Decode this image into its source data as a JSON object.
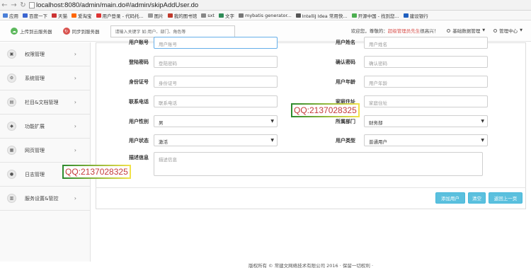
{
  "browser": {
    "url": "localhost:8080/admin/main.do#/admin/skipAddUser.do",
    "bookmarks": [
      {
        "label": "应用",
        "color": "#4a7fd8"
      },
      {
        "label": "百度一下",
        "color": "#3b65d1"
      },
      {
        "label": "天猫",
        "color": "#c33"
      },
      {
        "label": "爱淘宝",
        "color": "#f60"
      },
      {
        "label": "用户登录 - 代码托...",
        "color": "#d33"
      },
      {
        "label": "图片",
        "color": "#999"
      },
      {
        "label": "我的图书馆",
        "color": "#c0392b"
      },
      {
        "label": "sxt",
        "color": "#888"
      },
      {
        "label": "文字",
        "color": "#2e8b57"
      },
      {
        "label": "mybatis generator...",
        "color": "#777"
      },
      {
        "label": "IntelliJ Idea 常用快...",
        "color": "#555"
      },
      {
        "label": "开源中国 - 找到您...",
        "color": "#4caf50"
      },
      {
        "label": "建设银行",
        "color": "#1f5fbf"
      }
    ]
  },
  "header": {
    "upload_label": "上传到云服务器",
    "sync_label": "同步到服务器",
    "search_placeholder": "请输入关键字 如:用户、部门、角色等",
    "welcome_prefix": "欢迎您，尊敬的：",
    "welcome_name": "超级管理员先生",
    "welcome_suffix": " 很高兴！",
    "basic_data": "基础数据管理",
    "admin_center": "管理中心"
  },
  "sidebar": {
    "items": [
      {
        "label": "权限管理",
        "icon": "lock-icon"
      },
      {
        "label": "系统管理",
        "icon": "gear-icon"
      },
      {
        "label": "栏目&文档管理",
        "icon": "document-icon"
      },
      {
        "label": "功能扩展",
        "icon": "plugin-icon"
      },
      {
        "label": "网页管理",
        "icon": "page-icon"
      },
      {
        "label": "日志管理",
        "icon": "log-icon"
      },
      {
        "label": "服务设置&管控",
        "icon": "server-icon"
      }
    ]
  },
  "form": {
    "username": {
      "label": "用户账号",
      "placeholder": "用户账号"
    },
    "realname": {
      "label": "用户姓名",
      "placeholder": "用户姓名"
    },
    "password": {
      "label": "登陆密码",
      "placeholder": "登陆密码"
    },
    "confirm": {
      "label": "确认密码",
      "placeholder": "确认密码"
    },
    "idcard": {
      "label": "身份证号",
      "placeholder": "身份证号"
    },
    "age": {
      "label": "用户年龄",
      "placeholder": "用户年龄"
    },
    "phone": {
      "label": "联系电话",
      "placeholder": "联系电话"
    },
    "address": {
      "label": "家庭住址",
      "placeholder": "家庭住址"
    },
    "gender": {
      "label": "用户性别",
      "value": "男"
    },
    "dept": {
      "label": "所属部门",
      "value": "财务部"
    },
    "status": {
      "label": "用户状态",
      "value": "激活"
    },
    "type": {
      "label": "用户类型",
      "value": "普通用户"
    },
    "desc": {
      "label": "描述信息",
      "placeholder": "描述信息"
    }
  },
  "buttons": {
    "add": "添加用户",
    "reset": "清空",
    "back": "返回上一页"
  },
  "watermark": "QQ:2137028325",
  "footer": "版权所有 © 常建文网络技术有限公司 2016 · 保留一切权利 ·"
}
